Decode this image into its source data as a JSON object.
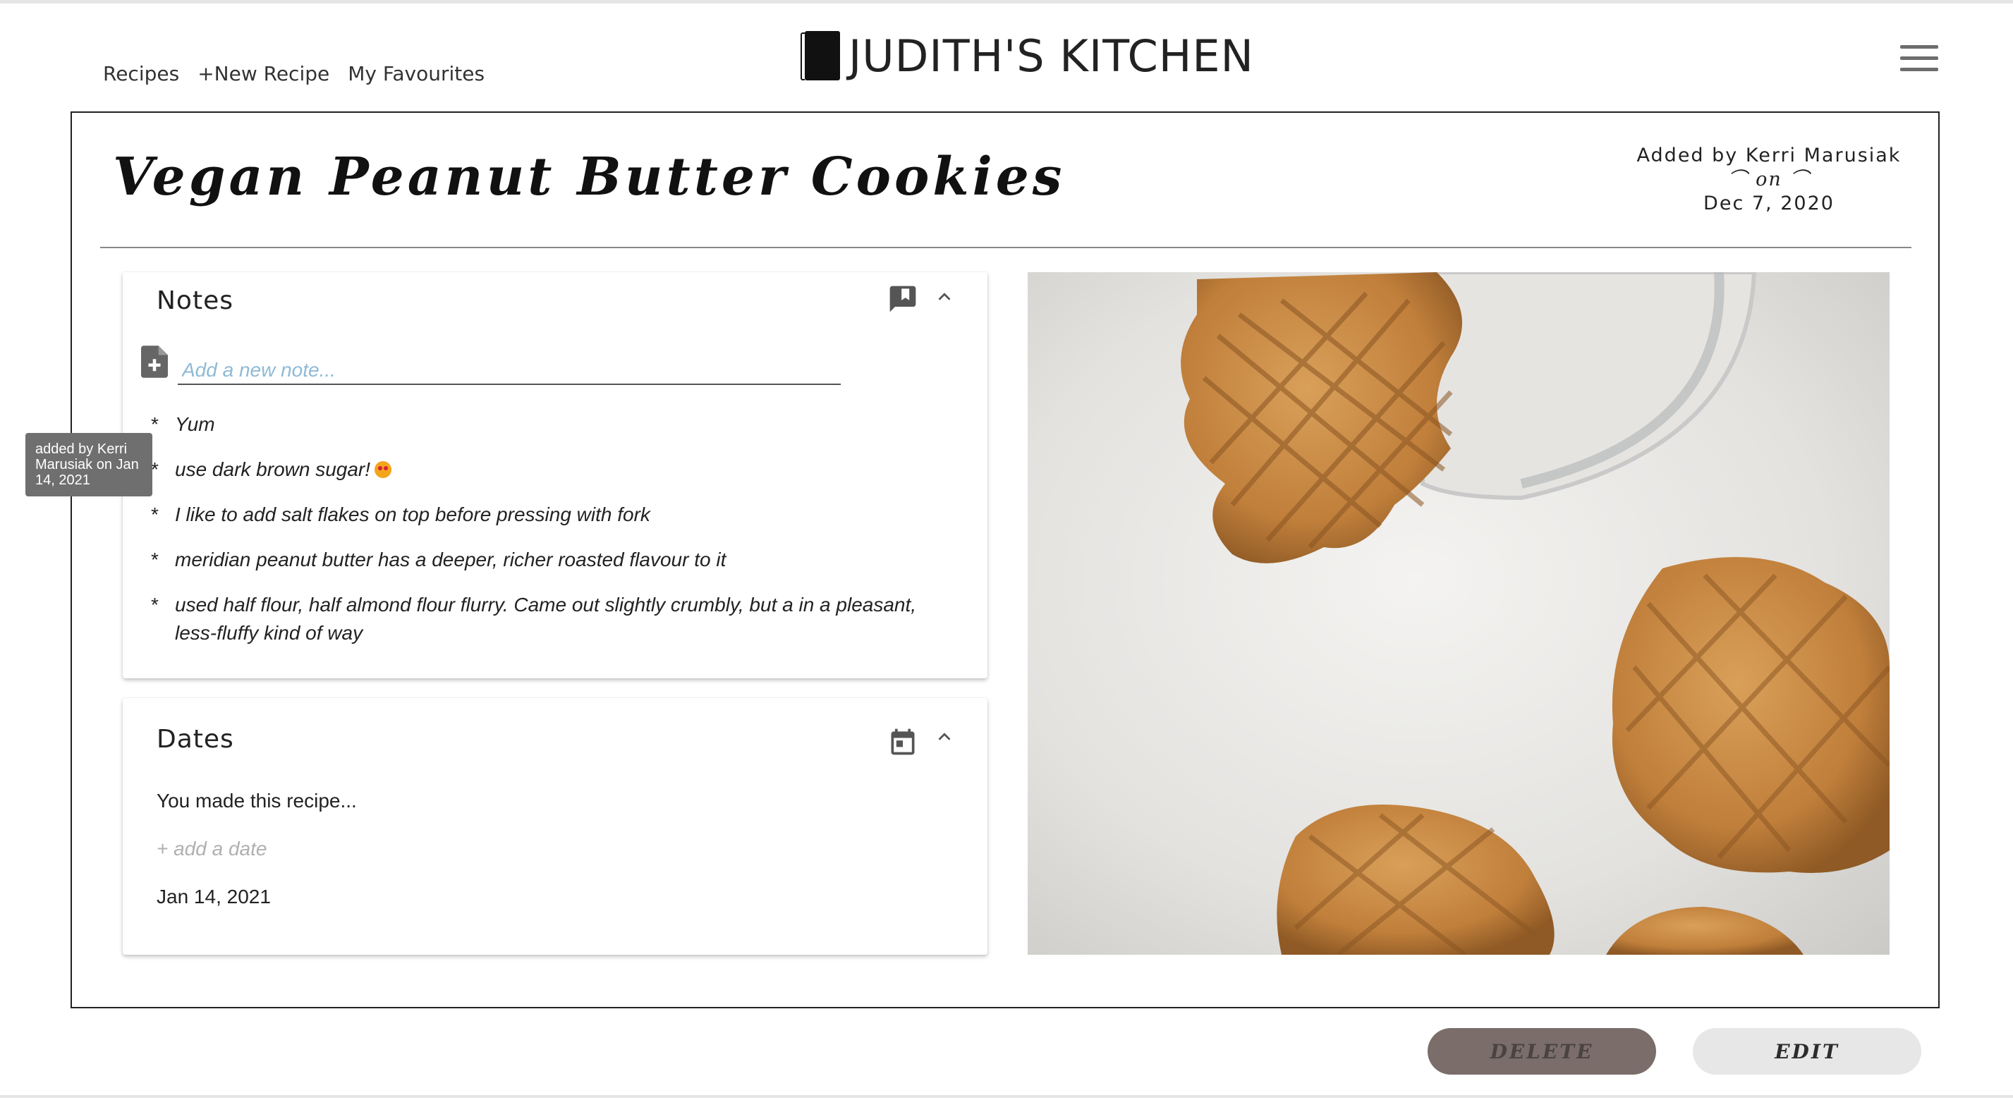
{
  "nav": {
    "recipes": "Recipes",
    "new_recipe": "+New Recipe",
    "favourites": "My Favourites"
  },
  "brand": {
    "name": "JUDITH'S KITCHEN"
  },
  "recipe": {
    "title": "Vegan Peanut Butter Cookies",
    "added_by": "Added by Kerri Marusiak",
    "on_label": "⌒ on ⌒",
    "date_added": "Dec 7, 2020"
  },
  "notes": {
    "title": "Notes",
    "placeholder": "Add a new note...",
    "items": [
      "Yum",
      "use dark brown sugar!",
      "I like to add salt flakes on top before pressing with fork",
      "meridian peanut butter has a deeper, richer roasted flavour to it",
      "used half flour, half almond flour flurry. Came out slightly crumbly, but a in a pleasant, less-fluffy kind of way"
    ],
    "bullet": "*"
  },
  "tooltip": {
    "text": "added by Kerri Marusiak on Jan 14, 2021"
  },
  "dates": {
    "title": "Dates",
    "made_text": "You made this recipe...",
    "add_date": "+ add a date",
    "entries": [
      "Jan 14, 2021"
    ]
  },
  "actions": {
    "delete": "DELETE",
    "edit": "EDIT"
  },
  "icons": {
    "book": "book-icon",
    "menu": "hamburger-menu-icon",
    "notes": "comment-bookmark-icon",
    "add_note": "note-add-icon",
    "calendar": "calendar-icon",
    "collapse": "chevron-up-icon"
  }
}
